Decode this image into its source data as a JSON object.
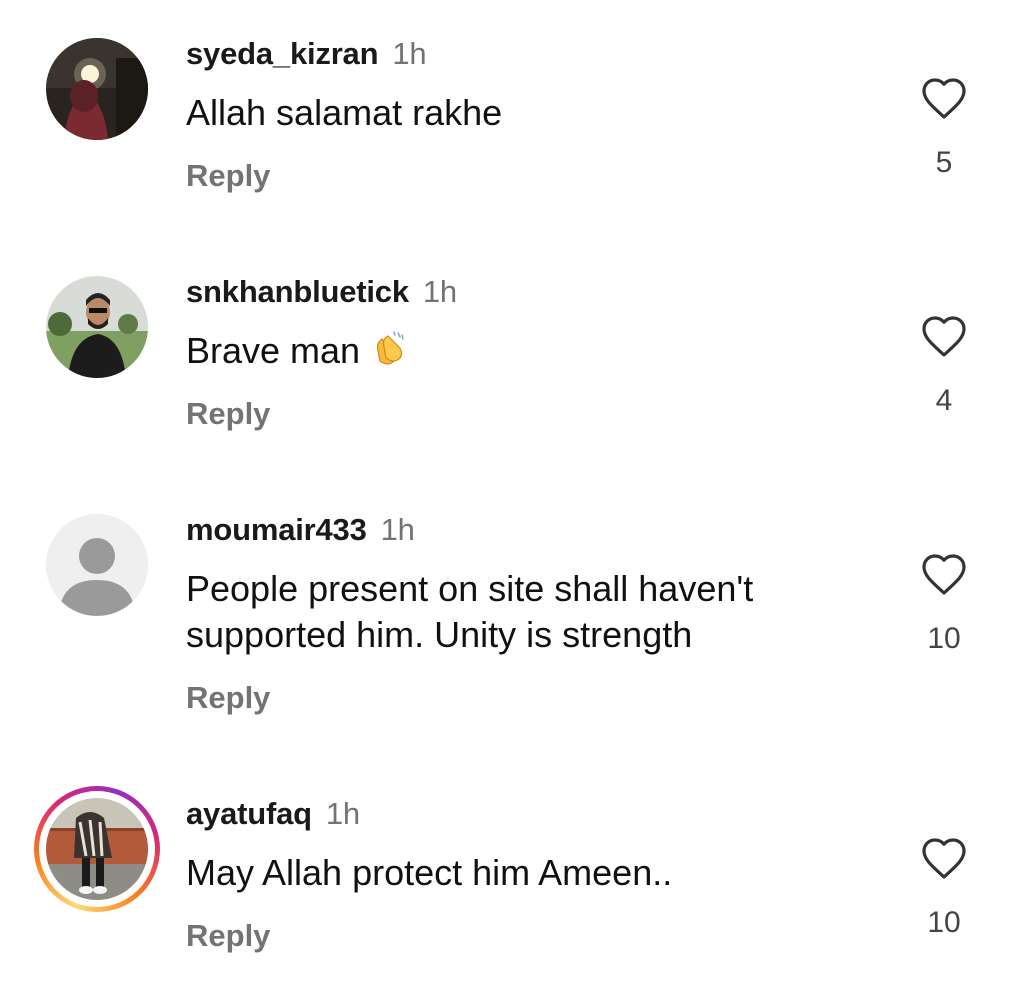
{
  "comments": [
    {
      "username": "syeda_kizran",
      "time": "1h",
      "text": "Allah salamat rakhe",
      "reply_label": "Reply",
      "likes": "5",
      "has_story_ring": false
    },
    {
      "username": "snkhanbluetick",
      "time": "1h",
      "text": "Brave man",
      "emoji": "clapping-hands",
      "reply_label": "Reply",
      "likes": "4",
      "has_story_ring": false
    },
    {
      "username": "moumair433",
      "time": "1h",
      "text_line1": "People present on site shall haven't",
      "text_line2": "supported him. Unity is strength",
      "reply_label": "Reply",
      "likes": "10",
      "has_story_ring": false,
      "avatar": "default-person-icon"
    },
    {
      "username": "ayatufaq",
      "time": "1h",
      "text": "May Allah protect him Ameen..",
      "reply_label": "Reply",
      "likes": "10",
      "has_story_ring": true
    }
  ],
  "icons": {
    "like": "heart-outline-icon"
  },
  "colors": {
    "secondary_text": "#737373",
    "primary_text": "#111111",
    "background": "#ffffff"
  }
}
